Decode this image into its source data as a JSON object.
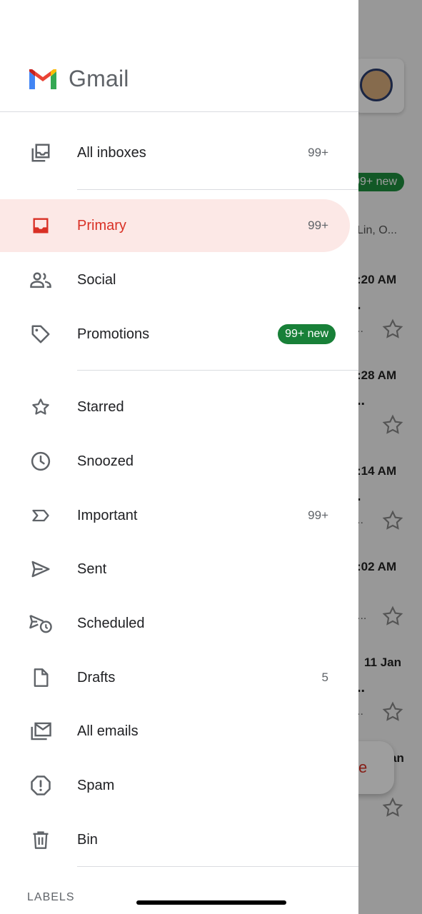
{
  "app": {
    "name": "Gmail"
  },
  "background": {
    "new_badge": "99+ new",
    "snippet": "Lin, O...",
    "times": [
      ":20 AM",
      ":28 AM",
      ":14 AM",
      ":02 AM",
      "11 Jan",
      "an"
    ],
    "compose_partial": "e"
  },
  "drawer": {
    "items": [
      {
        "label": "All inboxes",
        "count": "99+"
      },
      {
        "label": "Primary",
        "count": "99+"
      },
      {
        "label": "Social"
      },
      {
        "label": "Promotions",
        "badge": "99+ new"
      },
      {
        "label": "Starred"
      },
      {
        "label": "Snoozed"
      },
      {
        "label": "Important",
        "count": "99+"
      },
      {
        "label": "Sent"
      },
      {
        "label": "Scheduled"
      },
      {
        "label": "Drafts",
        "count": "5"
      },
      {
        "label": "All emails"
      },
      {
        "label": "Spam"
      },
      {
        "label": "Bin"
      }
    ],
    "labels_header": "LABELS"
  },
  "colors": {
    "accent_red": "#d93025",
    "active_bg": "#fce8e6",
    "badge_green": "#188038",
    "icon_grey": "#5f6368"
  }
}
